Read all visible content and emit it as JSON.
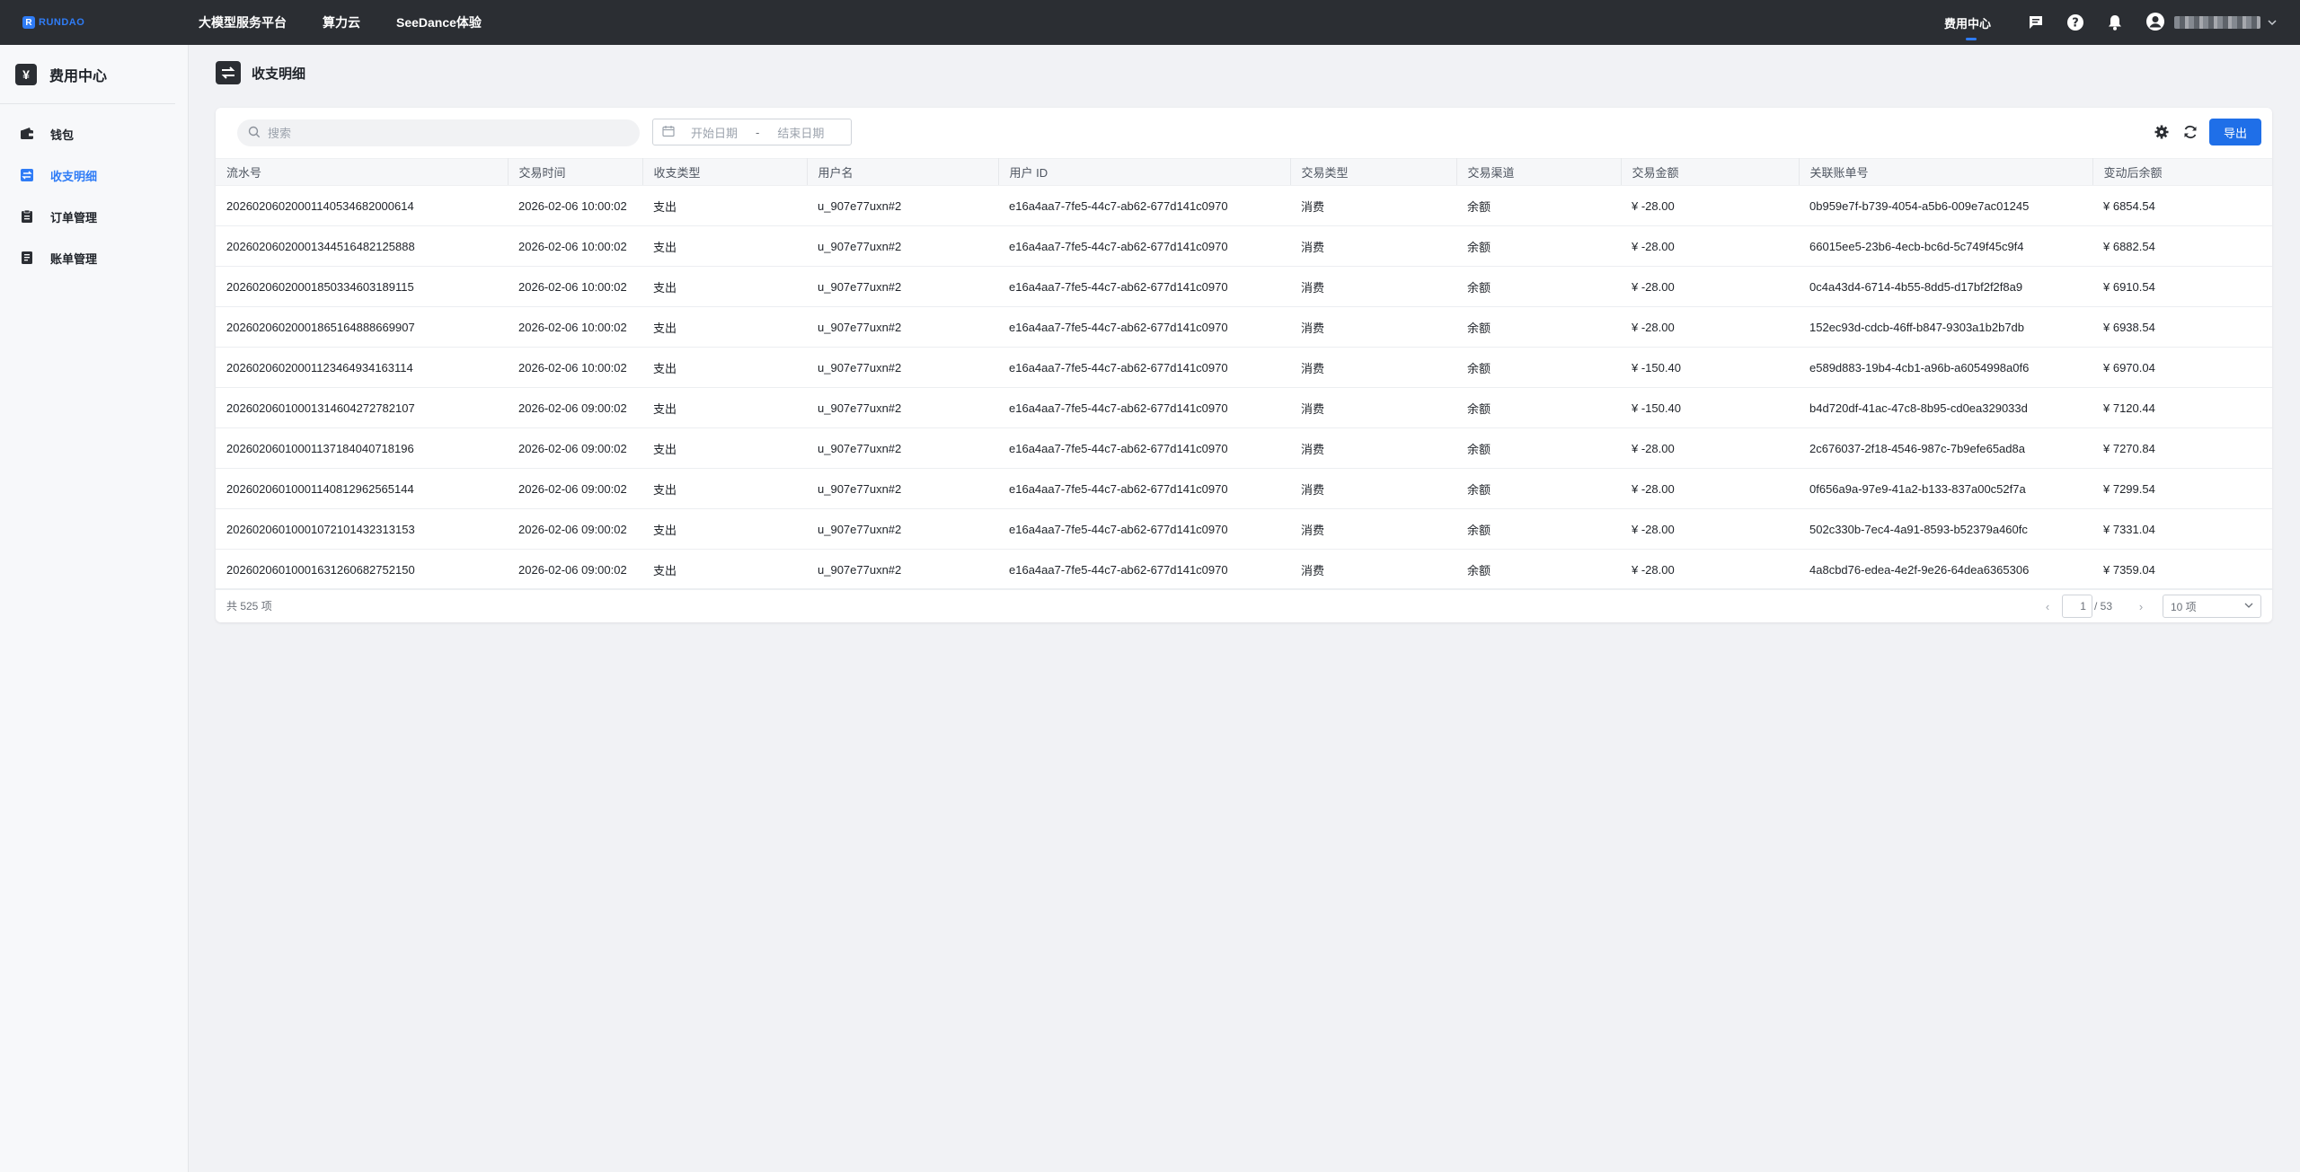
{
  "topbar": {
    "logo_text": "RUNDAO",
    "nav": [
      "大模型服务平台",
      "算力云",
      "SeeDance体验"
    ],
    "active_label": "费用中心"
  },
  "sidebar": {
    "title": "费用中心",
    "items": [
      {
        "label": "钱包",
        "icon": "wallet-icon",
        "active": false
      },
      {
        "label": "收支明细",
        "icon": "transactions-icon",
        "active": true
      },
      {
        "label": "订单管理",
        "icon": "clipboard-icon",
        "active": false
      },
      {
        "label": "账单管理",
        "icon": "receipt-icon",
        "active": false
      }
    ]
  },
  "page": {
    "title": "收支明细"
  },
  "toolbar": {
    "search_placeholder": "搜索",
    "date_start_placeholder": "开始日期",
    "date_sep": "-",
    "date_end_placeholder": "结束日期",
    "export_label": "导出"
  },
  "table": {
    "columns": [
      "流水号",
      "交易时间",
      "收支类型",
      "用户名",
      "用户 ID",
      "交易类型",
      "交易渠道",
      "交易金额",
      "关联账单号",
      "变动后余额"
    ],
    "rows": [
      [
        "20260206020001140534682000614",
        "2026-02-06 10:00:02",
        "支出",
        "u_907e77uxn#2",
        "e16a4aa7-7fe5-44c7-ab62-677d141c0970",
        "消费",
        "余额",
        "¥ -28.00",
        "0b959e7f-b739-4054-a5b6-009e7ac01245",
        "¥ 6854.54"
      ],
      [
        "20260206020001344516482125888",
        "2026-02-06 10:00:02",
        "支出",
        "u_907e77uxn#2",
        "e16a4aa7-7fe5-44c7-ab62-677d141c0970",
        "消费",
        "余额",
        "¥ -28.00",
        "66015ee5-23b6-4ecb-bc6d-5c749f45c9f4",
        "¥ 6882.54"
      ],
      [
        "20260206020001850334603189115",
        "2026-02-06 10:00:02",
        "支出",
        "u_907e77uxn#2",
        "e16a4aa7-7fe5-44c7-ab62-677d141c0970",
        "消费",
        "余额",
        "¥ -28.00",
        "0c4a43d4-6714-4b55-8dd5-d17bf2f2f8a9",
        "¥ 6910.54"
      ],
      [
        "20260206020001865164888669907",
        "2026-02-06 10:00:02",
        "支出",
        "u_907e77uxn#2",
        "e16a4aa7-7fe5-44c7-ab62-677d141c0970",
        "消费",
        "余额",
        "¥ -28.00",
        "152ec93d-cdcb-46ff-b847-9303a1b2b7db",
        "¥ 6938.54"
      ],
      [
        "20260206020001123464934163114",
        "2026-02-06 10:00:02",
        "支出",
        "u_907e77uxn#2",
        "e16a4aa7-7fe5-44c7-ab62-677d141c0970",
        "消费",
        "余额",
        "¥ -150.40",
        "e589d883-19b4-4cb1-a96b-a6054998a0f6",
        "¥ 6970.04"
      ],
      [
        "20260206010001314604272782107",
        "2026-02-06 09:00:02",
        "支出",
        "u_907e77uxn#2",
        "e16a4aa7-7fe5-44c7-ab62-677d141c0970",
        "消费",
        "余额",
        "¥ -150.40",
        "b4d720df-41ac-47c8-8b95-cd0ea329033d",
        "¥ 7120.44"
      ],
      [
        "20260206010001137184040718196",
        "2026-02-06 09:00:02",
        "支出",
        "u_907e77uxn#2",
        "e16a4aa7-7fe5-44c7-ab62-677d141c0970",
        "消费",
        "余额",
        "¥ -28.00",
        "2c676037-2f18-4546-987c-7b9efe65ad8a",
        "¥ 7270.84"
      ],
      [
        "20260206010001140812962565144",
        "2026-02-06 09:00:02",
        "支出",
        "u_907e77uxn#2",
        "e16a4aa7-7fe5-44c7-ab62-677d141c0970",
        "消费",
        "余额",
        "¥ -28.00",
        "0f656a9a-97e9-41a2-b133-837a00c52f7a",
        "¥ 7299.54"
      ],
      [
        "20260206010001072101432313153",
        "2026-02-06 09:00:02",
        "支出",
        "u_907e77uxn#2",
        "e16a4aa7-7fe5-44c7-ab62-677d141c0970",
        "消费",
        "余额",
        "¥ -28.00",
        "502c330b-7ec4-4a91-8593-b52379a460fc",
        "¥ 7331.04"
      ],
      [
        "20260206010001631260682752150",
        "2026-02-06 09:00:02",
        "支出",
        "u_907e77uxn#2",
        "e16a4aa7-7fe5-44c7-ab62-677d141c0970",
        "消费",
        "余额",
        "¥ -28.00",
        "4a8cbd76-edea-4e2f-9e26-64dea6365306",
        "¥ 7359.04"
      ]
    ]
  },
  "footer": {
    "total_label": "共 525 项",
    "current_page": "1",
    "page_total": "/ 53",
    "page_size": "10 项"
  },
  "colors": {
    "accent": "#1f6fe8",
    "topbar": "#2b2e33",
    "background": "#f1f2f5"
  }
}
